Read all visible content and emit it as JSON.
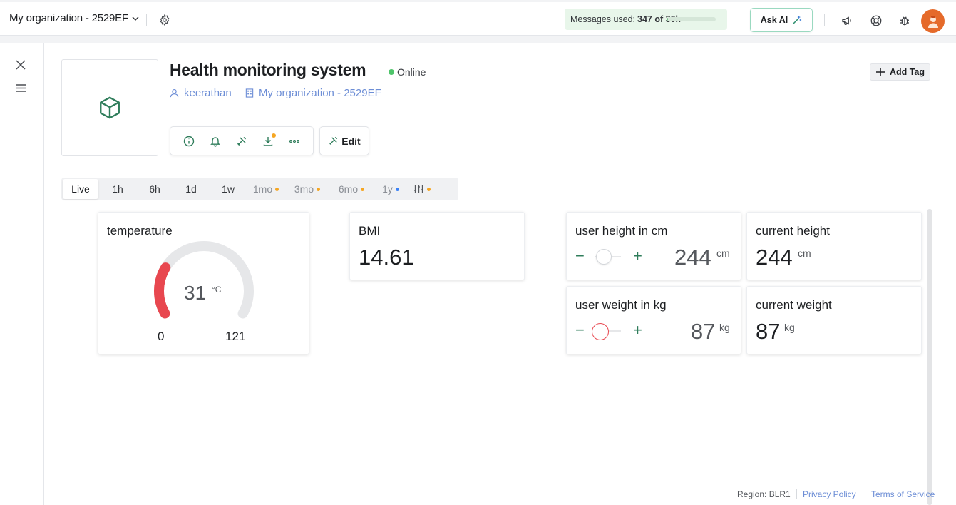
{
  "topbar": {
    "org_name": "My organization - 2529EF",
    "messages_label": "Messages used:",
    "messages_count": "347 of 30k",
    "messages_progress": 0.0116,
    "ask_ai_label": "Ask AI"
  },
  "device": {
    "title": "Health monitoring system",
    "status": "Online",
    "owner": "keerathan",
    "organization": "My organization - 2529EF",
    "add_tag_label": "Add Tag",
    "edit_label": "Edit"
  },
  "time_ranges": [
    {
      "label": "Live",
      "active": true,
      "dot": null
    },
    {
      "label": "1h",
      "active": false,
      "dot": null
    },
    {
      "label": "6h",
      "active": false,
      "dot": null
    },
    {
      "label": "1d",
      "active": false,
      "dot": null
    },
    {
      "label": "1w",
      "active": false,
      "dot": null
    },
    {
      "label": "1mo",
      "active": false,
      "dot": "#f5a623"
    },
    {
      "label": "3mo",
      "active": false,
      "dot": "#f5a623"
    },
    {
      "label": "6mo",
      "active": false,
      "dot": "#f5a623"
    },
    {
      "label": "1y",
      "active": false,
      "dot": "#3b82f6"
    }
  ],
  "widgets": {
    "temperature": {
      "label": "temperature",
      "value": "31",
      "unit": "°C",
      "min": "0",
      "max": "121",
      "value_num": 31,
      "min_num": 0,
      "max_num": 121,
      "color": "#e8474f"
    },
    "bmi": {
      "label": "BMI",
      "value": "14.61"
    },
    "height_control": {
      "label": "user height in cm",
      "value": "244",
      "unit": "cm",
      "minus": "−",
      "plus": "+"
    },
    "current_height": {
      "label": "current height",
      "value": "244",
      "unit": "cm"
    },
    "weight_control": {
      "label": "user weight in kg",
      "value": "87",
      "unit": "kg",
      "minus": "−",
      "plus": "+"
    },
    "current_weight": {
      "label": "current weight",
      "value": "87",
      "unit": "kg"
    }
  },
  "footer": {
    "region": "Region: BLR1",
    "privacy": "Privacy Policy",
    "terms": "Terms of Service"
  },
  "colors": {
    "accent_green": "#2f7d5b",
    "link_blue": "#6d8ed6",
    "online_green": "#4ec46a"
  }
}
